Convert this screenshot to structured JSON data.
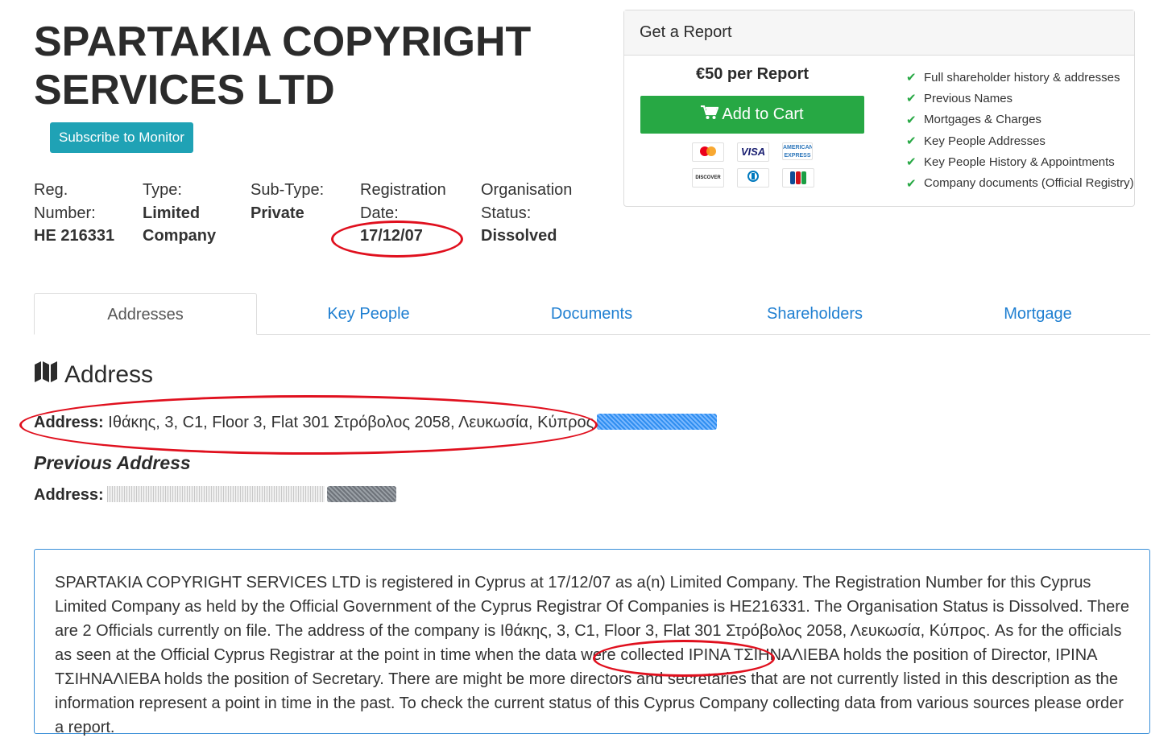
{
  "company": {
    "name": "SPARTAKIA COPYRIGHT SERVICES LTD",
    "subscribe_label": "Subscribe to Monitor"
  },
  "info": {
    "reg_label": "Reg. Number:",
    "reg_value": "HE 216331",
    "type_label": "Type:",
    "type_value": "Limited Company",
    "subtype_label": "Sub-Type:",
    "subtype_value": "Private",
    "regdate_label": "Registration Date:",
    "regdate_value": "17/12/07",
    "status_label": "Organisation Status:",
    "status_value": "Dissolved"
  },
  "report": {
    "header": "Get a Report",
    "price": "€50 per Report",
    "cart_label": "Add to Cart",
    "cards": [
      "mastercard",
      "VISA",
      "AMERICAN EXPRESS",
      "DISCOVER",
      "Diners Club",
      "JCB"
    ],
    "features": [
      "Full shareholder history & addresses",
      "Previous Names",
      "Mortgages & Charges",
      "Key People Addresses",
      "Key People History & Appointments",
      "Company documents (Official Registry)"
    ]
  },
  "tabs": [
    "Addresses",
    "Key People",
    "Documents",
    "Shareholders",
    "Mortgage"
  ],
  "address": {
    "section_title": "Address",
    "label": "Address:",
    "value": "Ιθάκης, 3, C1, Floor 3, Flat 301 Στρόβολος 2058, Λευκωσία, Κύπρος",
    "previous_title": "Previous Address",
    "previous_label": "Address:"
  },
  "description": "SPARTAKIA COPYRIGHT SERVICES LTD is registered in Cyprus at 17/12/07 as a(n) Limited Company. The Registration Number for this Cyprus Limited Company as held by the Official Government of the Cyprus Registrar Of Companies is HE216331. The Organisation Status is Dissolved. There are 2 Officials currently on file. The address of the company is Ιθάκης, 3, C1, Floor 3, Flat 301 Στρόβολος 2058, Λευκωσία, Κύπρος. As for the officials as seen at the Official Cyprus Registrar at the point in time when the data were collected ΙΡΙΝΑ ΤΣΙΗΝΑΛΙΕΒΑ holds the position of Director, ΙΡΙΝΑ ΤΣΙΗΝΑΛΙΕΒΑ holds the position of Secretary. There are might be more directors and secretaries that are not currently listed in this description as the information represent a point in time in the past. To check the current status of this Cyprus Company collecting data from various sources please order a report.",
  "colors": {
    "accent_teal": "#1fa2b5",
    "cart_green": "#27a844",
    "link_blue": "#1f7fd1",
    "annotation_red": "#e0101e"
  }
}
